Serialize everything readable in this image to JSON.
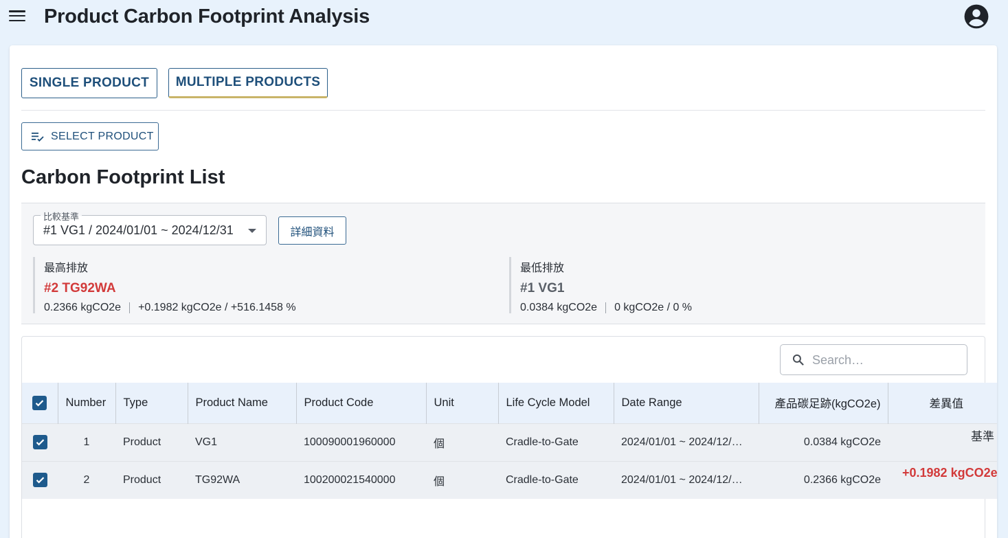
{
  "app": {
    "title": "Product Carbon Footprint Analysis"
  },
  "tabs": {
    "single": "SINGLE PRODUCT",
    "multiple": "MULTIPLE PRODUCTS"
  },
  "toolbar": {
    "select_product": "SELECT PRODUCT"
  },
  "section": {
    "title": "Carbon Footprint List"
  },
  "comparison": {
    "baseline_label": "比較基準",
    "baseline_value": "#1 VG1 / 2024/01/01 ~ 2024/12/31",
    "detail_button": "詳細資料",
    "highest": {
      "label": "最高排放",
      "name": "#2 TG92WA",
      "value": "0.2366 kgCO2e",
      "diff": "+0.1982 kgCO2e / +516.1458 %"
    },
    "lowest": {
      "label": "最低排放",
      "name": "#1 VG1",
      "value": "0.0384 kgCO2e",
      "diff": "0 kgCO2e / 0 %"
    }
  },
  "search": {
    "placeholder": "Search…"
  },
  "table": {
    "columns": [
      "Number",
      "Type",
      "Product Name",
      "Product Code",
      "Unit",
      "Life Cycle Model",
      "Date Range",
      "產品碳足跡(kgCO2e)",
      "差異值"
    ],
    "rows": [
      {
        "number": "1",
        "type": "Product",
        "name": "VG1",
        "code": "100090001960000",
        "unit": "個",
        "model": "Cradle-to-Gate",
        "date_range": "2024/01/01 ~ 2024/12/…",
        "footprint": "0.0384 kgCO2e",
        "diff": "基準"
      },
      {
        "number": "2",
        "type": "Product",
        "name": "TG92WA",
        "code": "100200021540000",
        "unit": "個",
        "model": "Cradle-to-Gate",
        "date_range": "2024/01/01 ~ 2024/12/…",
        "footprint": "0.2366 kgCO2e",
        "diff": "+0.1982 kgCO2e"
      }
    ]
  },
  "colors": {
    "primary": "#1e5a8c",
    "accent_underline": "#c9b468",
    "danger": "#d23a3a",
    "background": "#e8f2fc"
  },
  "icons": {
    "menu": "menu-icon",
    "account": "account-circle-icon",
    "select": "checklist-icon",
    "search": "search-icon",
    "dropdown": "caret-down-icon",
    "checkbox": "checkbox-checked-icon"
  }
}
